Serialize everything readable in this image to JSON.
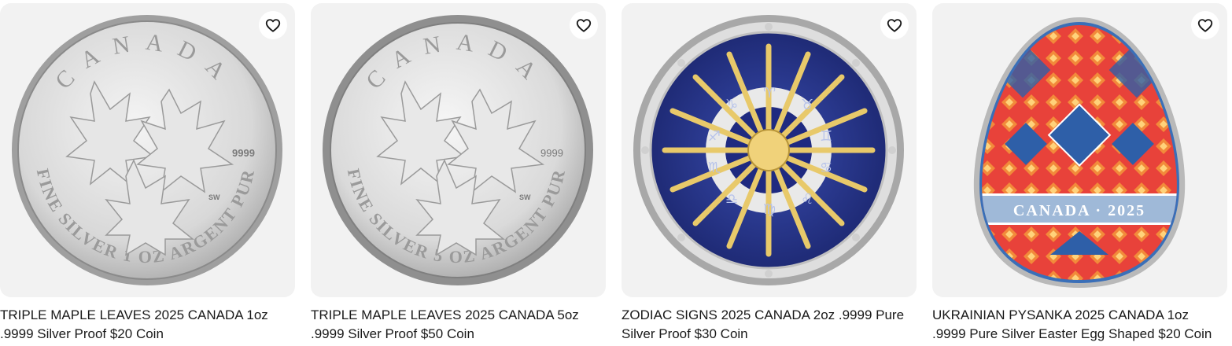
{
  "listings": [
    {
      "title": "TRIPLE MAPLE LEAVES 2025 CANADA 1oz .9999 Silver Proof $20 Coin",
      "coin_text": {
        "top": "CANADA",
        "bottom": "FINE SILVER 1 OZ ARGENT PUR",
        "purity": "9999",
        "mark": "SW"
      },
      "favorite_icon": "heart-outline-icon"
    },
    {
      "title": "TRIPLE MAPLE LEAVES 2025 CANADA 5oz .9999 Silver Proof $50 Coin",
      "coin_text": {
        "top": "CANADA",
        "bottom": "FINE SILVER 5 OZ ARGENT PUR",
        "purity": "9999",
        "mark": "SW"
      },
      "favorite_icon": "heart-outline-icon"
    },
    {
      "title": "ZODIAC SIGNS 2025 CANADA 2oz .9999 Pure Silver Proof $30 Coin",
      "favorite_icon": "heart-outline-icon"
    },
    {
      "title": "UKRAINIAN PYSANKA 2025 CANADA 1oz .9999 Pure Silver Easter Egg Shaped $20 Coin",
      "coin_text": {
        "band": "CANADA · 2025"
      },
      "favorite_icon": "heart-outline-icon"
    }
  ],
  "colors": {
    "thumb_bg": "#f2f2f2",
    "silver": "#c9c9c9",
    "zodiac_blue": "#2b3a8f",
    "sun_gold": "#e8c96a",
    "pysanka_red": "#e8423a"
  }
}
